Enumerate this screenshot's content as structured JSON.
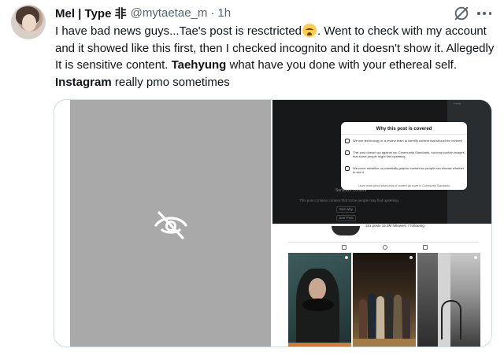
{
  "tweet": {
    "author": {
      "name": "Mel | Type 非",
      "handle": "@mytaetae_m",
      "separator": "·",
      "time": "1h"
    },
    "text": {
      "part1": "I have bad news guys...Tae's post is resctricted",
      "emoji": "loudly-crying-face",
      "part2": ". Went to check with my account and it showed like this first, then I checked incognito and it doesn't show it. Allegedly It is sensitive content. ",
      "bold1": "Taehyung",
      "part3": " what have you done with your ethereal self. ",
      "bold2": "Instagram",
      "part4": " really pmo sometimes"
    },
    "actions": {
      "hide_icon": "eye-slash-icon",
      "more_icon": "more-dots-icon"
    }
  },
  "media": {
    "left_panel": {
      "state": "sensitive-hidden",
      "icon": "eye-off-icon",
      "background": "#a9a9a9"
    },
    "screenshot": {
      "dialog_title": "Why this post is covered",
      "rows": [
        "We use technology or a review team to identify content that should be covered.",
        "This post doesn't go against our Community Standards, but may contain images that some people might find upsetting.",
        "We cover sensitive or potentially graphic content so people can choose whether to see it."
      ],
      "learn_more": "Learn more about what kinds of content we cover in Community Standards",
      "covered_label": "Sensitive Content",
      "covered_sub": "This post contains content that some people may find upsetting.",
      "see_why": "See why",
      "see_post": "See Post",
      "stats": "151 posts   15.3M followers   7 following"
    }
  },
  "colors": {
    "text": "#0f1419",
    "muted": "#536471",
    "border": "#cfd9de"
  }
}
